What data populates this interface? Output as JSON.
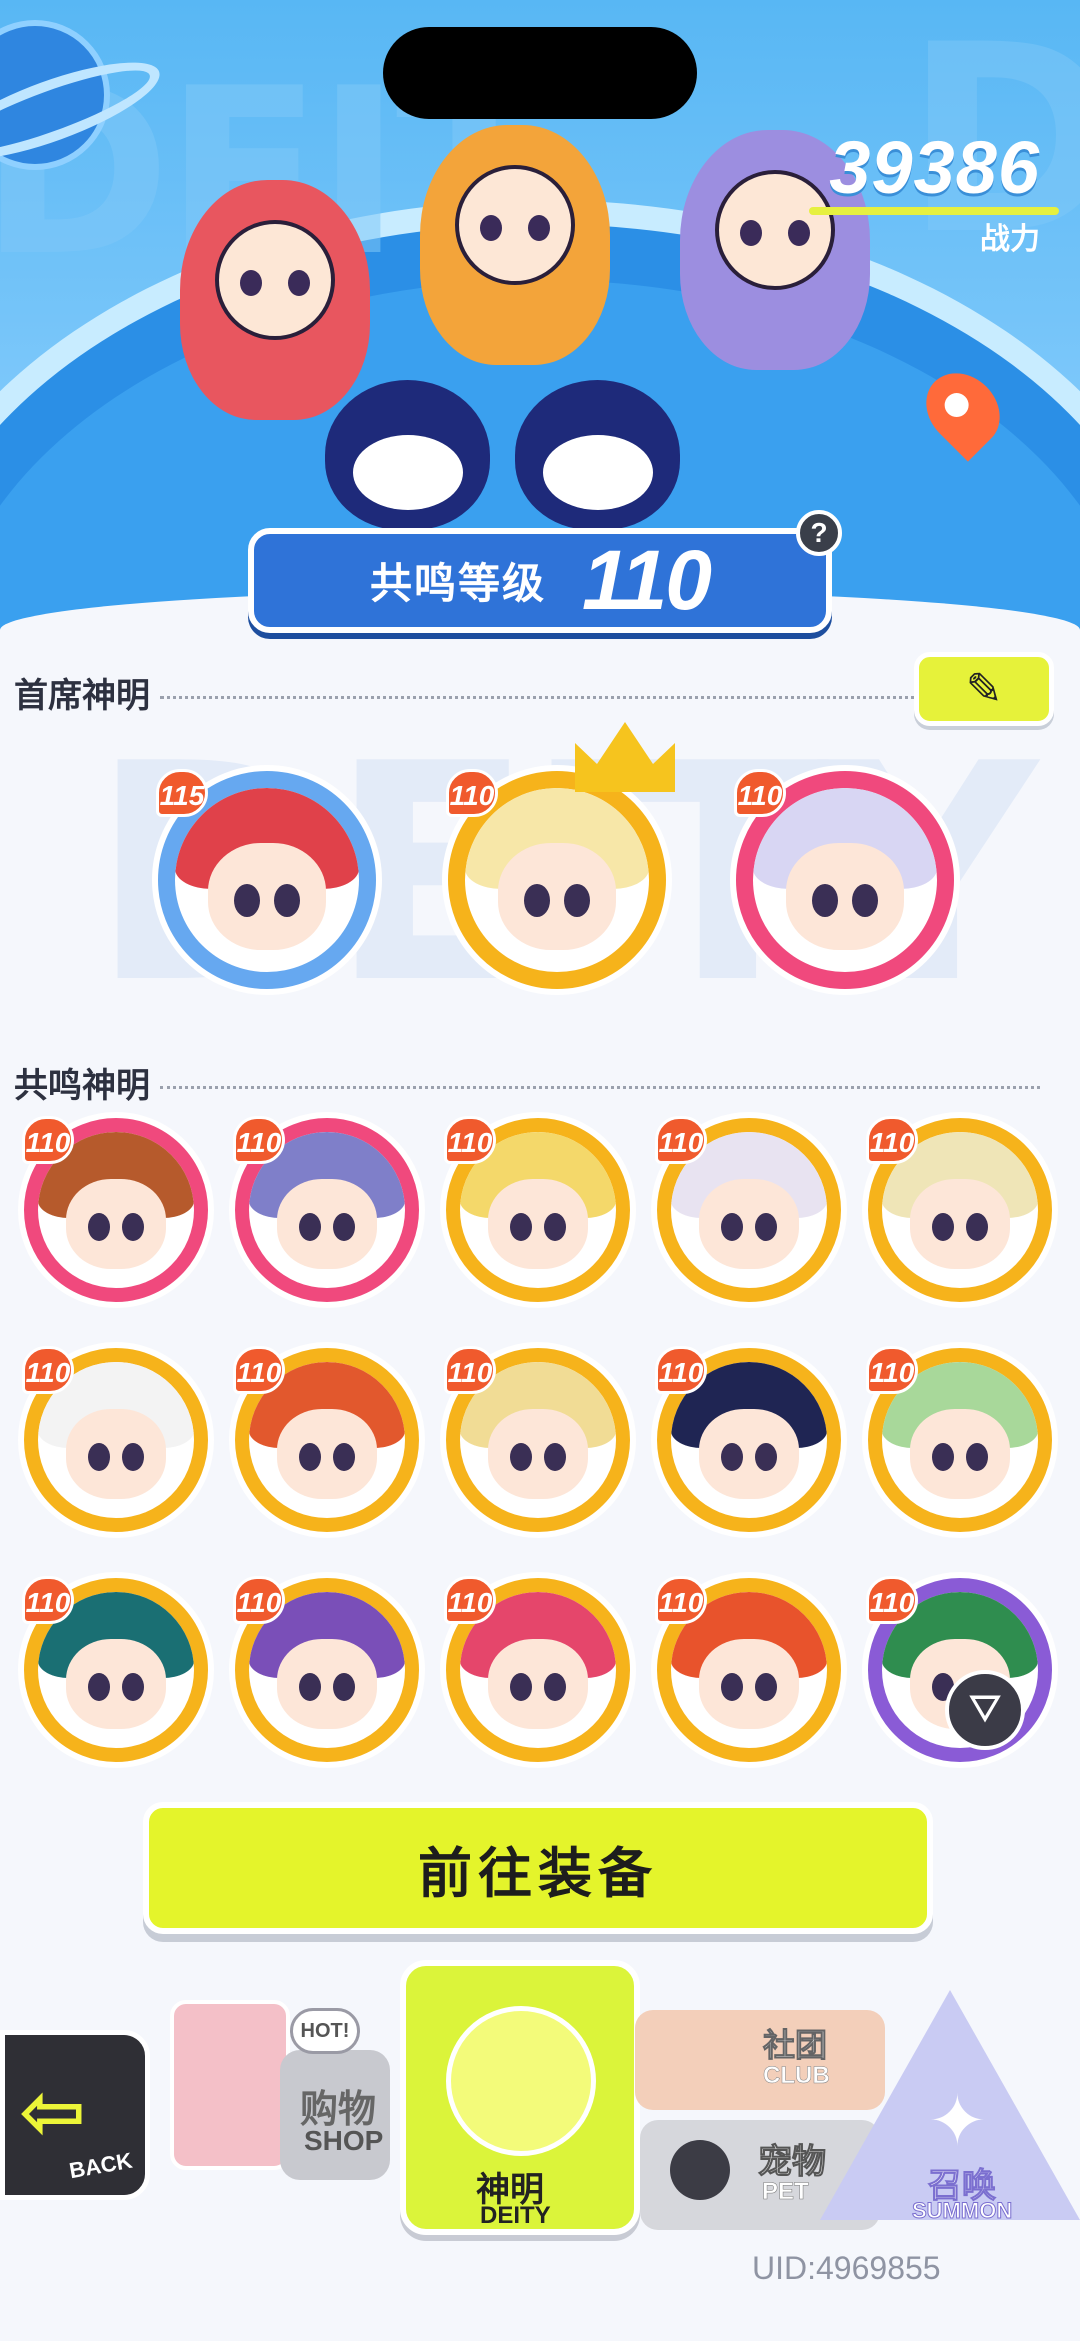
{
  "hero": {
    "power_value": "39386",
    "power_label": "战力",
    "bg_word_left": "DEIT",
    "bg_word_right": "D"
  },
  "resonance": {
    "label": "共鸣等级",
    "value": "110",
    "help": "?"
  },
  "chief": {
    "title": "首席神明",
    "edit_icon": "pencil-icon",
    "deities": [
      {
        "level": "115",
        "ring": "#66a8f0",
        "hair": "#e0414a"
      },
      {
        "level": "110",
        "ring": "#f6b31b",
        "hair": "#f7e7a8",
        "crowned": true
      },
      {
        "level": "110",
        "ring": "#f0497d",
        "hair": "#d8d6f3"
      }
    ]
  },
  "resonance_list": {
    "title": "共鸣神明",
    "deities": [
      {
        "level": "110",
        "ring": "#f0497d",
        "hair": "#b65a2c"
      },
      {
        "level": "110",
        "ring": "#f0497d",
        "hair": "#7f7fc9"
      },
      {
        "level": "110",
        "ring": "#f6b31b",
        "hair": "#f4d86a"
      },
      {
        "level": "110",
        "ring": "#f6b31b",
        "hair": "#e8e3f1"
      },
      {
        "level": "110",
        "ring": "#f6b31b",
        "hair": "#efe5b7"
      },
      {
        "level": "110",
        "ring": "#f6b31b",
        "hair": "#f3f3f3"
      },
      {
        "level": "110",
        "ring": "#f6b31b",
        "hair": "#e2582d"
      },
      {
        "level": "110",
        "ring": "#f6b31b",
        "hair": "#f1dc95"
      },
      {
        "level": "110",
        "ring": "#f6b31b",
        "hair": "#1f2553"
      },
      {
        "level": "110",
        "ring": "#f6b31b",
        "hair": "#a8d89a"
      },
      {
        "level": "110",
        "ring": "#f6b31b",
        "hair": "#1a6f73"
      },
      {
        "level": "110",
        "ring": "#f6b31b",
        "hair": "#7a4fb8"
      },
      {
        "level": "110",
        "ring": "#f6b31b",
        "hair": "#e5466b"
      },
      {
        "level": "110",
        "ring": "#f6b31b",
        "hair": "#e8532c"
      },
      {
        "level": "110",
        "ring": "#8a5bd6",
        "hair": "#2f8d4f"
      }
    ]
  },
  "go_equip": "前往装备",
  "nav": {
    "back": "BACK",
    "shop_cn": "购物",
    "shop_en": "SHOP",
    "shop_hot": "HOT!",
    "deity_cn": "神明",
    "deity_en": "DEITY",
    "club_cn": "社团",
    "club_en": "CLUB",
    "pet_cn": "宠物",
    "pet_en": "PET",
    "summon_cn": "召唤",
    "summon_en": "SUMMON"
  },
  "uid": "UID:4969855",
  "colors": {
    "accent_lime": "#e4f42b",
    "resonance_blue": "#2f73d8",
    "level_badge": "#f05a2d"
  }
}
